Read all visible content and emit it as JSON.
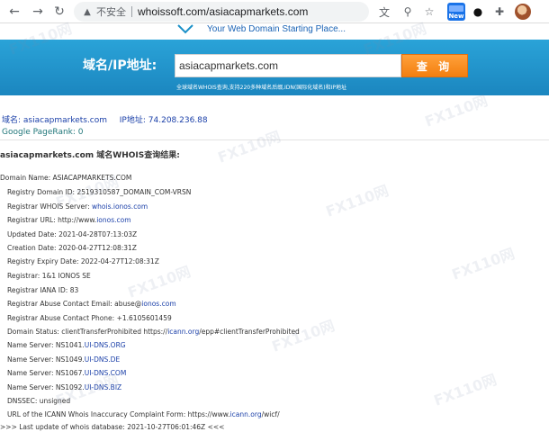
{
  "browser": {
    "insecure_label": "不安全",
    "url": "whoissoft.com/asiacapmarkets.com",
    "new_badge": "New"
  },
  "site": {
    "slogan": "Your Web Domain Starting Place...",
    "search_label": "域名/IP地址:",
    "search_value": "asiacapmarkets.com",
    "search_button": "查 询",
    "search_note": "全球域名WHOIS查询,支持220多种域名后缀,IDN(国际化域名)和IP地址",
    "watermark": "FX110网"
  },
  "summary": {
    "domain_label": "域名:",
    "domain": "asiacapmarkets.com",
    "ip_label": "IP地址:",
    "ip": "74.208.236.88",
    "pagerank_label": "Google PageRank:",
    "pagerank": "0"
  },
  "result": {
    "domain": "asiacapmarkets.com",
    "title_suffix": "域名WHOIS查询结果:"
  },
  "whois": {
    "domain_name": "Domain Name: ASIACAPMARKETS.COM",
    "registry_id": "Registry Domain ID: 2519310587_DOMAIN_COM-VRSN",
    "whois_server_label": "Registrar WHOIS Server:",
    "whois_server": "whois.ionos.com",
    "url_label": "Registrar URL: http://www.",
    "url_link": "ionos.com",
    "updated": "Updated Date: 2021-04-28T07:13:03Z",
    "created": "Creation Date: 2020-04-27T12:08:31Z",
    "expiry": "Registry Expiry Date: 2022-04-27T12:08:31Z",
    "registrar": "Registrar: 1&1 IONOS SE",
    "iana": "Registrar IANA ID: 83",
    "abuse_email_label": "Registrar Abuse Contact Email: abuse@",
    "abuse_email_link": "ionos.com",
    "abuse_phone": "Registrar Abuse Contact Phone: +1.6105601459",
    "status_label": "Domain Status: clientTransferProhibited https://",
    "status_link": "icann.org",
    "status_tail": "/epp#clientTransferProhibited",
    "ns": [
      {
        "prefix": "Name Server: NS1041.",
        "link": "UI-DNS.ORG"
      },
      {
        "prefix": "Name Server: NS1049.",
        "link": "UI-DNS.DE"
      },
      {
        "prefix": "Name Server: NS1067.",
        "link": "UI-DNS.COM"
      },
      {
        "prefix": "Name Server: NS1092.",
        "link": "UI-DNS.BIZ"
      }
    ],
    "dnssec": "DNSSEC: unsigned",
    "icann_label": "URL of the ICANN Whois Inaccuracy Complaint Form: https://www.",
    "icann_link": "icann.org",
    "icann_tail": "/wicf/",
    "last_update": ">>> Last update of whois database: 2021-10-27T06:01:46Z <<<"
  }
}
